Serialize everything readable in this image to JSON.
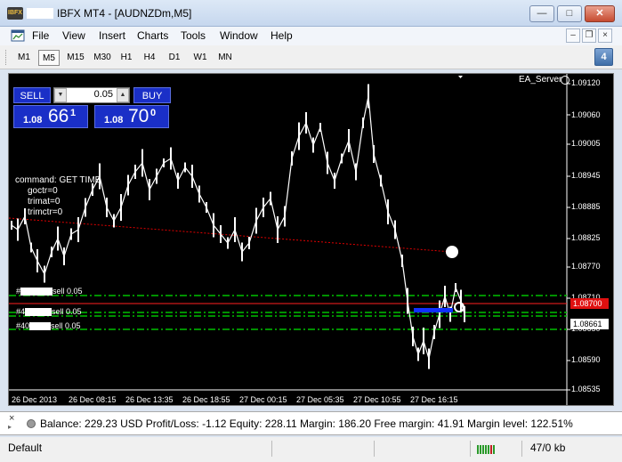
{
  "window": {
    "title": "IBFX MT4 - [AUDNZDm,M5]",
    "app_icon_text": "IBFX"
  },
  "menu": {
    "items": [
      "File",
      "View",
      "Insert",
      "Charts",
      "Tools",
      "Window",
      "Help"
    ]
  },
  "timeframes": {
    "items": [
      "M1",
      "M5",
      "M15",
      "M30",
      "H1",
      "H4",
      "D1",
      "W1",
      "MN"
    ],
    "active": "M5"
  },
  "messages": {
    "count": "4"
  },
  "trade_panel": {
    "sell_label": "SELL",
    "buy_label": "BUY",
    "lot": "0.05",
    "bid": {
      "prefix": "1.08",
      "big": "66",
      "sup": "1"
    },
    "ask": {
      "prefix": "1.08",
      "big": "70",
      "sup": "0"
    }
  },
  "chart": {
    "ea_name": "EA_Server",
    "command_lines": [
      "command: GET TIME",
      "goctr=0",
      "trimat=0",
      "trimctr=0"
    ],
    "orders": [
      {
        "prefix": "#",
        "text": "sell 0.05"
      },
      {
        "prefix": "#4",
        "text": "sell 0.05"
      },
      {
        "prefix": "#40",
        "text": "sell 0.05"
      }
    ],
    "price_axis": [
      "1.09120",
      "1.09060",
      "1.09005",
      "1.08945",
      "1.08885",
      "1.08825",
      "1.08770",
      "1.08710",
      "1.08650",
      "1.08590",
      "1.08535"
    ],
    "current_price_red": "1.08700",
    "current_price_white": "1.08661",
    "time_axis": [
      "26 Dec 2013",
      "26 Dec 08:15",
      "26 Dec 13:35",
      "26 Dec 18:55",
      "27 Dec 00:15",
      "27 Dec 05:35",
      "27 Dec 10:55",
      "27 Dec 16:15"
    ],
    "colors": {
      "background": "#000000",
      "candles": "#ffffff",
      "order_lines": "#00c000",
      "bid_line": "#ff2020",
      "trendline": "#e00000"
    }
  },
  "terminal": {
    "balance": "Balance: 229.23 USD  Profit/Loss: -1.12  Equity: 228.11  Margin: 186.20  Free margin: 41.91  Margin level: 122.51%"
  },
  "status": {
    "profile": "Default",
    "traffic": "47/0 kb"
  }
}
